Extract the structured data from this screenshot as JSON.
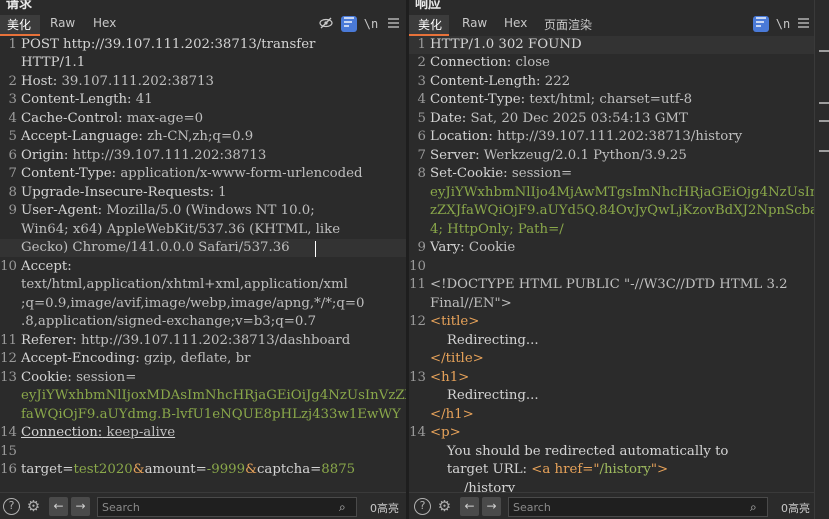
{
  "request": {
    "title": "请求",
    "tabs": [
      "美化",
      "Raw",
      "Hex"
    ],
    "active_tab": "美化",
    "toolbar": {
      "eye_icon": "eye-off-icon",
      "wrap_icon": "word-wrap-icon",
      "newline_label": "\\n",
      "menu_icon": "hamburger-menu-icon"
    },
    "lines": {
      "1": {
        "num": "1",
        "a": "POST http://39.107.111.202:38713/transfer",
        "b": "HTTP/1.1"
      },
      "2": {
        "num": "2",
        "name": "Host:",
        "value": " 39.107.111.202:38713"
      },
      "3": {
        "num": "3",
        "name": "Content-Length:",
        "value": " 41"
      },
      "4": {
        "num": "4",
        "name": "Cache-Control:",
        "value": " max-age=0"
      },
      "5": {
        "num": "5",
        "name": "Accept-Language:",
        "value": " zh-CN,zh;q=0.9"
      },
      "6": {
        "num": "6",
        "name": "Origin:",
        "value": " http://39.107.111.202:38713"
      },
      "7": {
        "num": "7",
        "name": "Content-Type:",
        "value": " application/x-www-form-urlencoded"
      },
      "8": {
        "num": "8",
        "name": "Upgrade-Insecure-Requests:",
        "value": " 1"
      },
      "9": {
        "num": "9",
        "name": "User-Agent:",
        "value": " Mozilla/5.0 (Windows NT 10.0;",
        "b": "Win64; x64) AppleWebKit/537.36 (KHTML, like",
        "c": "Gecko) Chrome/141.0.0.0 Safari/537.36"
      },
      "10": {
        "num": "10",
        "name": "Accept:",
        "b": "text/html,application/xhtml+xml,application/xml",
        "c": ";q=0.9,image/avif,image/webp,image/apng,*/*;q=0",
        "d": ".8,application/signed-exchange;v=b3;q=0.7"
      },
      "11": {
        "num": "11",
        "name": "Referer:",
        "value": " http://39.107.111.202:38713/dashboard"
      },
      "12": {
        "num": "12",
        "name": "Accept-Encoding:",
        "value": " gzip, deflate, br"
      },
      "13": {
        "num": "13",
        "name": "Cookie:",
        "value": " session=",
        "b": "eyJiYWxhbmNlIjoxMDAsImNhcHRjaGEiOiJg4NzUsInVzZXJ",
        "c": "faWQiOjF9.aUYdmg.B-lvfU1eNQUE8pHLzj433w1EwWY"
      },
      "14": {
        "num": "14",
        "name": "Connection:",
        "value": " keep-alive"
      },
      "15": {
        "num": "15"
      },
      "16": {
        "num": "16",
        "k1": "target",
        "v1": "test2020",
        "k2": "amount",
        "v2": "-9999",
        "k3": "captcha",
        "v3": "8875",
        "eq": "=",
        "amp": "&"
      }
    },
    "search": {
      "placeholder": "Search",
      "count": "0高亮"
    }
  },
  "response": {
    "title": "响应",
    "tabs": [
      "美化",
      "Raw",
      "Hex",
      "页面渲染"
    ],
    "active_tab": "美化",
    "toolbar": {
      "wrap_icon": "word-wrap-icon",
      "newline_label": "\\n",
      "menu_icon": "hamburger-menu-icon"
    },
    "lines": {
      "1": {
        "num": "1",
        "a": "HTTP/1.0 302 FOUND"
      },
      "2": {
        "num": "2",
        "name": "Connection:",
        "value": " close"
      },
      "3": {
        "num": "3",
        "name": "Content-Length:",
        "value": " 222"
      },
      "4": {
        "num": "4",
        "name": "Content-Type:",
        "value": " text/html; charset=utf-8"
      },
      "5": {
        "num": "5",
        "name": "Date:",
        "value": " Sat, 20 Dec 2025 03:54:13 GMT"
      },
      "6": {
        "num": "6",
        "name": "Location:",
        "value": " http://39.107.111.202:38713/history"
      },
      "7": {
        "num": "7",
        "name": "Server:",
        "value": " Werkzeug/2.0.1 Python/3.9.25"
      },
      "8": {
        "num": "8",
        "name": "Set-Cookie:",
        "value": " session=",
        "b": "eyJiYWxhbmNlIjo4MjAwMTgsImNhcHRjaGEiOjg4NzUsInV",
        "c": "zZXJfaWQiOjF9.aUYd5Q.84OvJyQwLjKzovBdXJ2NpnScba",
        "d": "4; HttpOnly; Path=/"
      },
      "9": {
        "num": "9",
        "name": "Vary:",
        "value": " Cookie"
      },
      "10": {
        "num": "10"
      },
      "11": {
        "num": "11",
        "a": "<!DOCTYPE HTML PUBLIC \"-//W3C//DTD HTML 3.2",
        "b": "Final//EN\">"
      },
      "12": {
        "num": "12",
        "open": "<title>",
        "text": "    Redirecting...",
        "close": "</title>"
      },
      "13": {
        "num": "13",
        "open": "<h1>",
        "text": "    Redirecting...",
        "close": "</h1>"
      },
      "14": {
        "num": "14",
        "open": "<p>",
        "text": "    You should be redirected automatically to",
        "b_pre": "    target URL: ",
        "b_tag": "<a href=\"",
        "b_attr": "/history",
        "b_end": "\">",
        "c": "        /history"
      }
    },
    "search": {
      "placeholder": "Search",
      "count": "0高亮"
    }
  }
}
